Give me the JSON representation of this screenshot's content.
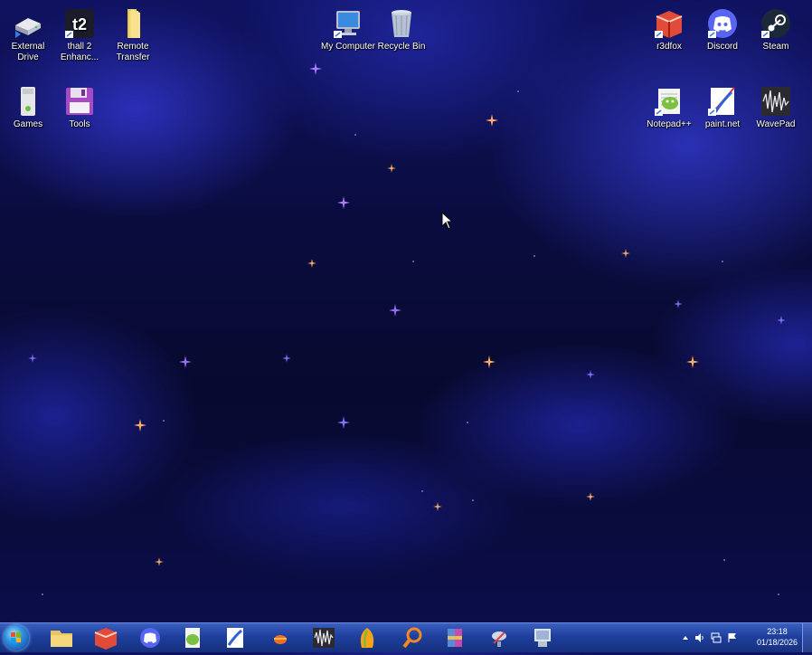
{
  "desktop": {
    "icons": [
      {
        "label": "External Drive",
        "icon": "external-drive-icon"
      },
      {
        "label": "thall 2 Enhanc...",
        "icon": "t2-app-icon"
      },
      {
        "label": "Remote Transfer",
        "icon": "folder-icon"
      },
      {
        "label": "My Computer",
        "icon": "computer-icon"
      },
      {
        "label": "Recycle Bin",
        "icon": "recycle-bin-icon"
      },
      {
        "label": "r3dfox",
        "icon": "r3dfox-icon"
      },
      {
        "label": "Discord",
        "icon": "discord-icon"
      },
      {
        "label": "Steam",
        "icon": "steam-icon"
      },
      {
        "label": "Games",
        "icon": "games-icon"
      },
      {
        "label": "Tools",
        "icon": "floppy-disk-icon"
      },
      {
        "label": "Notepad++",
        "icon": "notepad-plus-plus-icon"
      },
      {
        "label": "paint.net",
        "icon": "paint-net-icon"
      },
      {
        "label": "WavePad",
        "icon": "wavepad-icon"
      }
    ]
  },
  "taskbar": {
    "start_icon": "windows-start-orb-icon",
    "pinned": [
      "file-explorer-icon",
      "r3dfox-icon",
      "discord-icon",
      "notepad-plus-plus-icon",
      "paint-net-icon",
      "orange-app-icon",
      "wavepad-icon",
      "fl-studio-icon",
      "search-tool-icon",
      "winrar-icon",
      "satellite-app-icon",
      "device-manager-icon"
    ],
    "tray_icons": [
      "show-hidden-icons-icon",
      "volume-icon",
      "network-icon",
      "action-center-flag-icon"
    ],
    "clock": {
      "time": "23:18",
      "date": "01/18/2026"
    }
  },
  "colors": {
    "taskbar": "#1e3f9e",
    "background": "#0a0c3e",
    "star_orange": "#ffb060",
    "star_purple": "#b07cff"
  }
}
